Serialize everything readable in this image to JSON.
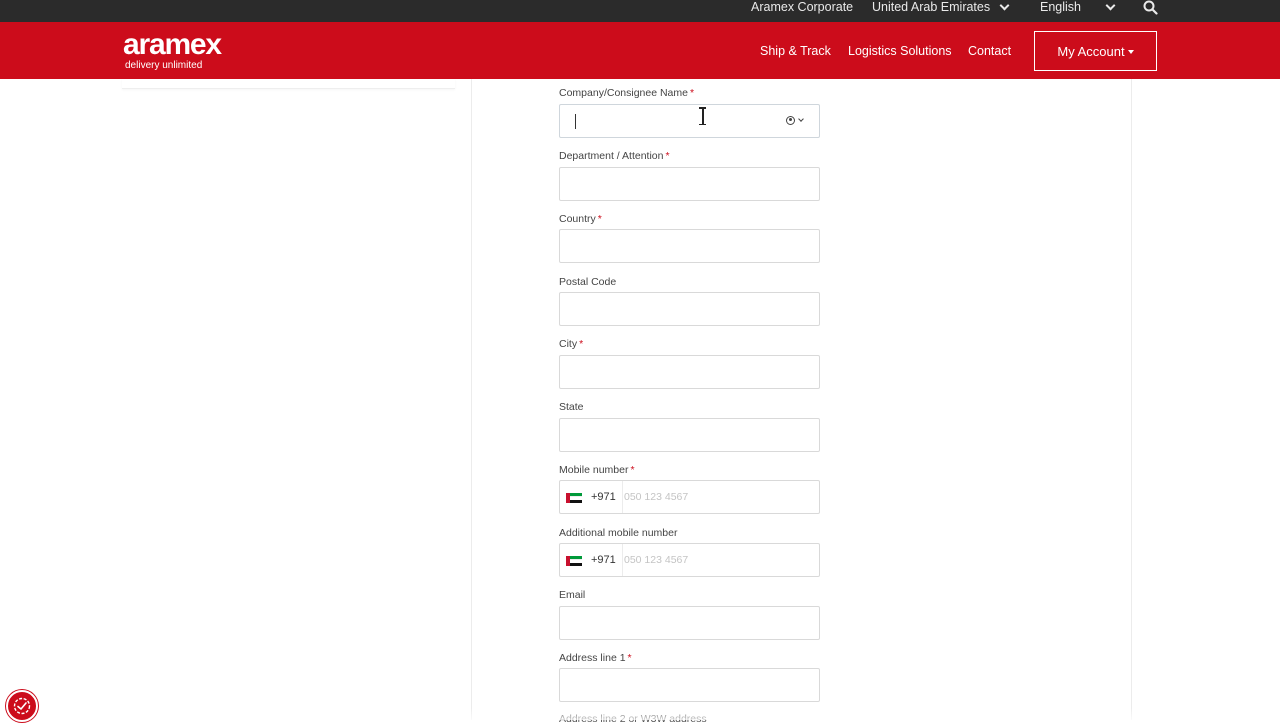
{
  "topbar": {
    "corporate": "Aramex Corporate",
    "country": "United Arab Emirates",
    "language": "English",
    "search_icon": "search-icon"
  },
  "header": {
    "logo_word": "aramex",
    "logo_tagline": "delivery unlimited",
    "nav": [
      "Ship & Track",
      "Logistics Solutions",
      "Contact"
    ],
    "account": "My Account"
  },
  "form": {
    "company": {
      "label": "Company/Consignee Name",
      "required": "*",
      "value": ""
    },
    "department": {
      "label": "Department / Attention",
      "required": "*",
      "value": ""
    },
    "country": {
      "label": "Country",
      "required": "*",
      "value": ""
    },
    "postal": {
      "label": "Postal Code",
      "value": ""
    },
    "city": {
      "label": "City",
      "required": "*",
      "value": ""
    },
    "state": {
      "label": "State",
      "value": ""
    },
    "mobile": {
      "label": "Mobile number",
      "required": "*",
      "dial_code": "+971",
      "placeholder": "050 123 4567"
    },
    "mobile2": {
      "label": "Additional mobile number",
      "dial_code": "+971",
      "placeholder": "050 123 4567"
    },
    "email": {
      "label": "Email",
      "value": ""
    },
    "address1": {
      "label": "Address line 1",
      "required": "*",
      "value": ""
    },
    "address2_partial": "Address line 2 or W3W address"
  },
  "colors": {
    "brand_red": "#cc0c1b",
    "topbar_bg": "#2b2b2b"
  }
}
